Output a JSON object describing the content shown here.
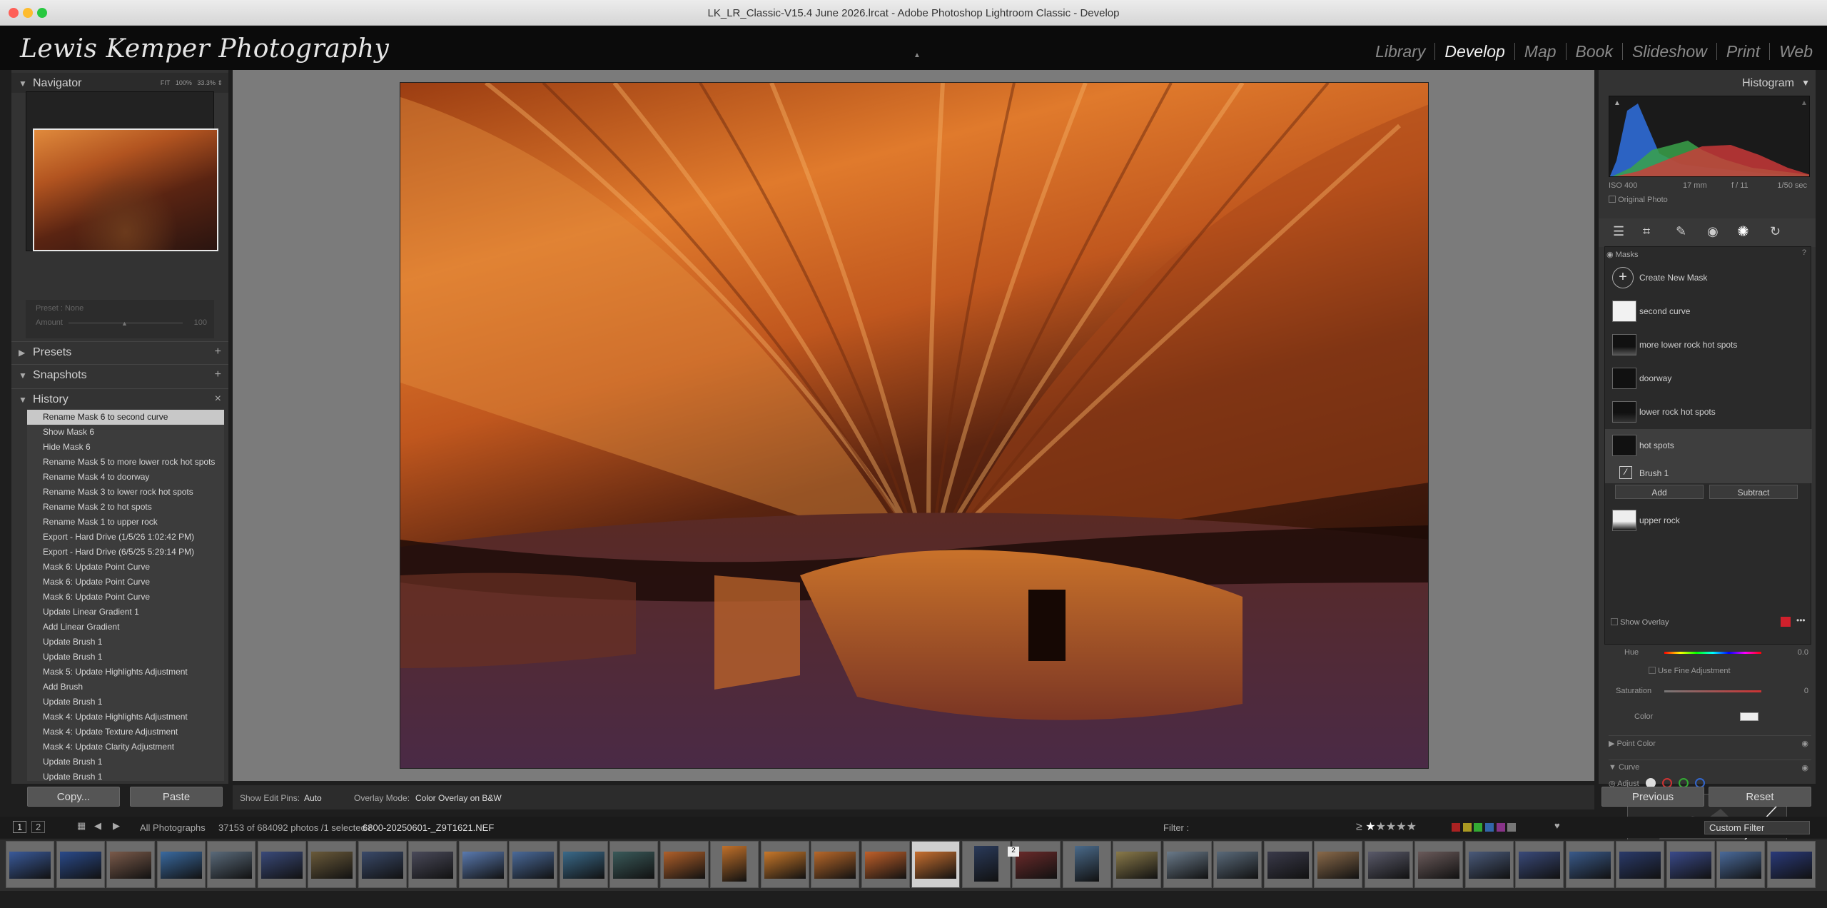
{
  "window": {
    "title": "LK_LR_Classic-V15.4 June  2026.lrcat - Adobe Photoshop Lightroom Classic - Develop"
  },
  "identity_plate": "Lewis Kemper Photography",
  "modules": [
    "Library",
    "Develop",
    "Map",
    "Book",
    "Slideshow",
    "Print",
    "Web"
  ],
  "active_module": "Develop",
  "navigator": {
    "title": "Navigator",
    "zoom": [
      "FIT",
      "100%",
      "33.3%"
    ]
  },
  "preset_box": {
    "preset": "Preset : None",
    "amount_label": "Amount",
    "amount_value": "100"
  },
  "panels": {
    "presets": "Presets",
    "snapshots": "Snapshots",
    "history": "History"
  },
  "history": [
    "Rename Mask 6 to second curve",
    "Show Mask 6",
    "Hide Mask 6",
    "Rename Mask 5 to more lower rock hot spots",
    "Rename Mask 4 to doorway",
    "Rename Mask 3 to lower rock hot spots",
    "Rename Mask 2 to hot spots",
    "Rename Mask 1 to upper rock",
    "Export - Hard Drive (1/5/26 1:02:42 PM)",
    "Export - Hard Drive (6/5/25 5:29:14 PM)",
    "Mask 6: Update Point Curve",
    "Mask 6: Update Point Curve",
    "Mask 6: Update Point Curve",
    "Update Linear Gradient 1",
    "Add Linear Gradient",
    "Update Brush 1",
    "Update Brush 1",
    "Mask 5: Update Highlights Adjustment",
    "Add Brush",
    "Update Brush 1",
    "Mask 4: Update Highlights Adjustment",
    "Mask 4: Update Texture Adjustment",
    "Mask 4: Update Clarity Adjustment",
    "Update Brush 1",
    "Update Brush 1"
  ],
  "left_buttons": {
    "copy": "Copy...",
    "paste": "Paste"
  },
  "toolbar": {
    "edit_pins_label": "Show Edit Pins:",
    "edit_pins_value": "Auto",
    "overlay_label": "Overlay Mode:",
    "overlay_value": "Color Overlay on B&W"
  },
  "histogram": {
    "title": "Histogram",
    "iso": "ISO 400",
    "focal": "17 mm",
    "aperture": "f / 11",
    "shutter": "1/50 sec",
    "original_photo": "Original Photo"
  },
  "masks": {
    "title": "Masks",
    "create": "Create New Mask",
    "items": [
      "second curve",
      "more lower rock hot spots",
      "doorway",
      "lower rock hot spots",
      "hot spots",
      "upper rock"
    ],
    "sub_item": "Brush 1",
    "add": "Add",
    "subtract": "Subtract",
    "show_overlay": "Show Overlay"
  },
  "adjust": {
    "hue": "Hue",
    "hue_value": "0.0",
    "fine": "Use Fine Adjustment",
    "saturation": "Saturation",
    "saturation_value": "0",
    "color": "Color",
    "point_color": "Point Color",
    "curve": "Curve",
    "adjust": "Adjust"
  },
  "right_buttons": {
    "previous": "Previous",
    "reset": "Reset"
  },
  "filmbar": {
    "pages": [
      "1",
      "2"
    ],
    "source": "All Photographs",
    "count": "37153 of 684092 photos /1 selected /",
    "file": "6800-20250601-_Z9T1621.NEF",
    "filter_label": "Filter :",
    "custom_filter": "Custom Filter",
    "stack_badge": "2"
  },
  "colors": {
    "accent": "#c8c8c8",
    "overlay_swatch": "#d0202c"
  }
}
